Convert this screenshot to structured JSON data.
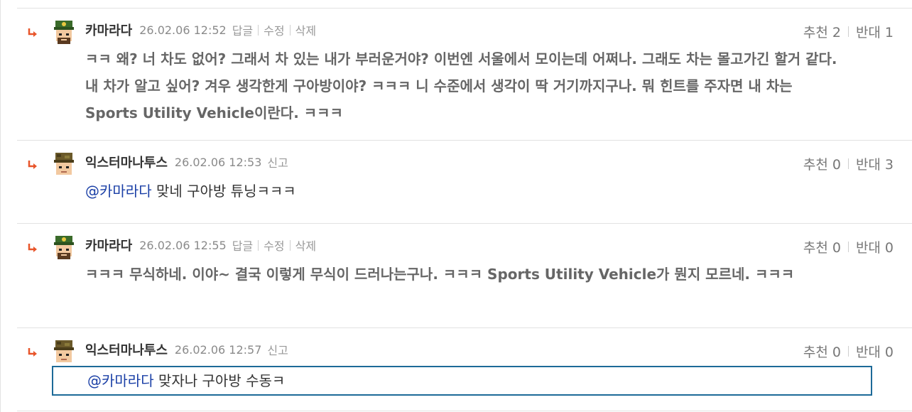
{
  "comments": [
    {
      "nick": "카마라다",
      "date": "26.02.06 12:52",
      "actions": [
        "답글",
        "수정",
        "삭제"
      ],
      "up_label": "추천",
      "up": "2",
      "down_label": "반대",
      "down": "1",
      "text": "ㅋㅋ 왜? 너 차도 없어? 그래서 차 있는 내가 부러운거야? 이번엔 서울에서 모이는데 어쩌나. 그래도 차는 몰고가긴 할거 같다. 내 차가 알고 싶어? 겨우 생각한게 구아방이야? ㅋㅋㅋ 니 수준에서 생각이 딱 거기까지구나. 뭐 힌트를 주자면 내 차는 Sports Utility Vehicle이란다. ㅋㅋㅋ"
    },
    {
      "nick": "익스터마나투스",
      "date": "26.02.06 12:53",
      "actions": [
        "신고"
      ],
      "up_label": "추천",
      "up": "0",
      "down_label": "반대",
      "down": "3",
      "mention": "@카마라다",
      "text": " 맞네 구아방 튜닝ㅋㅋㅋ"
    },
    {
      "nick": "카마라다",
      "date": "26.02.06 12:55",
      "actions": [
        "답글",
        "수정",
        "삭제"
      ],
      "up_label": "추천",
      "up": "0",
      "down_label": "반대",
      "down": "0",
      "text": "ㅋㅋㅋ 무식하네. 이야~ 결국 이렇게 무식이 드러나는구나. ㅋㅋㅋ Sports Utility Vehicle가 뭔지 모르네. ㅋㅋㅋ"
    },
    {
      "nick": "익스터마나투스",
      "date": "26.02.06 12:57",
      "actions": [
        "신고"
      ],
      "up_label": "추천",
      "up": "0",
      "down_label": "반대",
      "down": "0",
      "mention": "@카마라다",
      "text": " 맞자나 구아방 수동ㅋ"
    }
  ],
  "colors": {
    "arrow": "#e8552a",
    "mention": "#1a3fa6",
    "active_border": "#1d6a98"
  },
  "icons": {
    "reply": "reply-arrow-icon",
    "avatar_general": "general-avatar-icon",
    "avatar_soldier": "soldier-avatar-icon"
  }
}
